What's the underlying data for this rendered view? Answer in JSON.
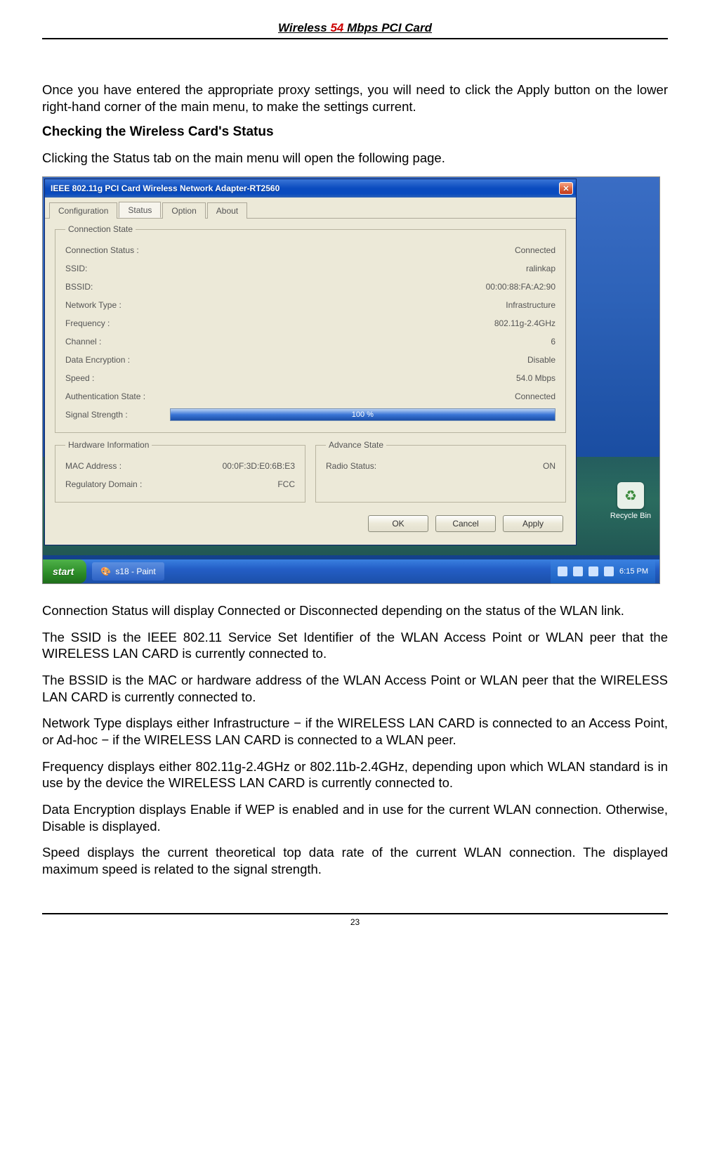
{
  "doc": {
    "header_pre": "Wireless ",
    "header_54": "54",
    "header_post": " Mbps PCI Card",
    "page_number": "23",
    "p1": "Once you have entered the appropriate proxy settings, you will need to click the Apply button on the lower right-hand corner of the main menu, to make the settings current.",
    "h1": "Checking the Wireless Card's Status",
    "p2": "Clicking the Status tab on the main menu will open the following page.",
    "p3": "Connection Status will display Connected or Disconnected depending on the status of the WLAN link.",
    "p4": "The SSID is the IEEE 802.11 Service Set Identifier of the WLAN Access Point or WLAN peer that the WIRELESS LAN CARD is currently connected to.",
    "p5": "The BSSID is the MAC or hardware address of the WLAN Access Point or WLAN peer that the WIRELESS LAN CARD is currently connected to.",
    "p6": "Network Type displays either Infrastructure − if the WIRELESS LAN CARD is connected to an Access Point, or Ad-hoc − if the WIRELESS LAN CARD is connected to a WLAN peer.",
    "p7": "Frequency displays either 802.11g-2.4GHz or 802.11b-2.4GHz, depending upon which WLAN standard is in use by the device the WIRELESS LAN CARD is currently connected to.",
    "p8": "Data Encryption displays Enable if WEP is enabled and in use for the current WLAN connection.  Otherwise, Disable is displayed.",
    "p9": "Speed displays the current theoretical top data rate of the current WLAN connection.  The displayed maximum speed is related to the signal strength."
  },
  "win": {
    "title": "IEEE 802.11g PCI Card Wireless Network Adapter-RT2560",
    "tabs": [
      "Configuration",
      "Status",
      "Option",
      "About"
    ],
    "active_tab_index": 1,
    "groups": {
      "conn_state_legend": "Connection State",
      "hardware_legend": "Hardware Information",
      "advance_legend": "Advance State"
    },
    "status": [
      {
        "label": "Connection Status :",
        "value": "Connected"
      },
      {
        "label": "SSID:",
        "value": "ralinkap"
      },
      {
        "label": "BSSID:",
        "value": "00:00:88:FA:A2:90"
      },
      {
        "label": "Network Type :",
        "value": "Infrastructure"
      },
      {
        "label": "Frequency :",
        "value": "802.11g-2.4GHz"
      },
      {
        "label": "Channel :",
        "value": "6"
      },
      {
        "label": "Data Encryption :",
        "value": "Disable"
      },
      {
        "label": "Speed :",
        "value": "54.0  Mbps"
      },
      {
        "label": "Authentication State :",
        "value": "Connected"
      }
    ],
    "signal_label": "Signal Strength :",
    "signal_value": "100 %",
    "hardware": [
      {
        "label": "MAC Address :",
        "value": "00:0F:3D:E0:6B:E3"
      },
      {
        "label": "Regulatory Domain :",
        "value": "FCC"
      }
    ],
    "advance": [
      {
        "label": "Radio Status:",
        "value": "ON"
      }
    ],
    "buttons": {
      "ok": "OK",
      "cancel": "Cancel",
      "apply": "Apply"
    }
  },
  "desktop": {
    "recycle": "Recycle Bin",
    "start": "start",
    "task_item": "s18 - Paint",
    "clock": "6:15 PM"
  }
}
